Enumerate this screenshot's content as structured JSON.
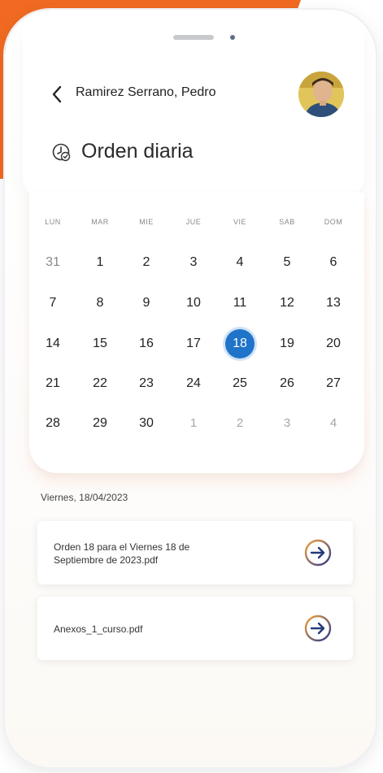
{
  "header": {
    "patient_name": "Ramirez Serrano, Pedro",
    "title": "Orden diaria"
  },
  "calendar": {
    "weekdays": [
      "LUN",
      "MAR",
      "MIE",
      "JUE",
      "VIE",
      "SAB",
      "DOM"
    ],
    "weeks": [
      [
        "31",
        "1",
        "2",
        "3",
        "4",
        "5",
        "6"
      ],
      [
        "7",
        "8",
        "9",
        "10",
        "11",
        "12",
        "13"
      ],
      [
        "14",
        "15",
        "16",
        "17",
        "18",
        "19",
        "20"
      ],
      [
        "21",
        "22",
        "23",
        "24",
        "25",
        "26",
        "27"
      ],
      [
        "28",
        "29",
        "30",
        "1",
        "2",
        "3",
        "4"
      ]
    ],
    "selected_day": "18",
    "accent_color": "#1f73c9"
  },
  "documents": {
    "date_label": "Viernes, 18/04/2023",
    "items": [
      {
        "line1": "Orden 18 para el Viernes 18 de",
        "line2": "Septiembre de 2023.pdf"
      },
      {
        "line1": "Anexos_1_curso.pdf",
        "line2": ""
      }
    ],
    "arrow_icon": "arrow-right-circle-icon"
  },
  "colors": {
    "brand_orange": "#f26a21",
    "arrow_gradient_start": "#f2a23a",
    "arrow_gradient_end": "#2e3a8c"
  }
}
